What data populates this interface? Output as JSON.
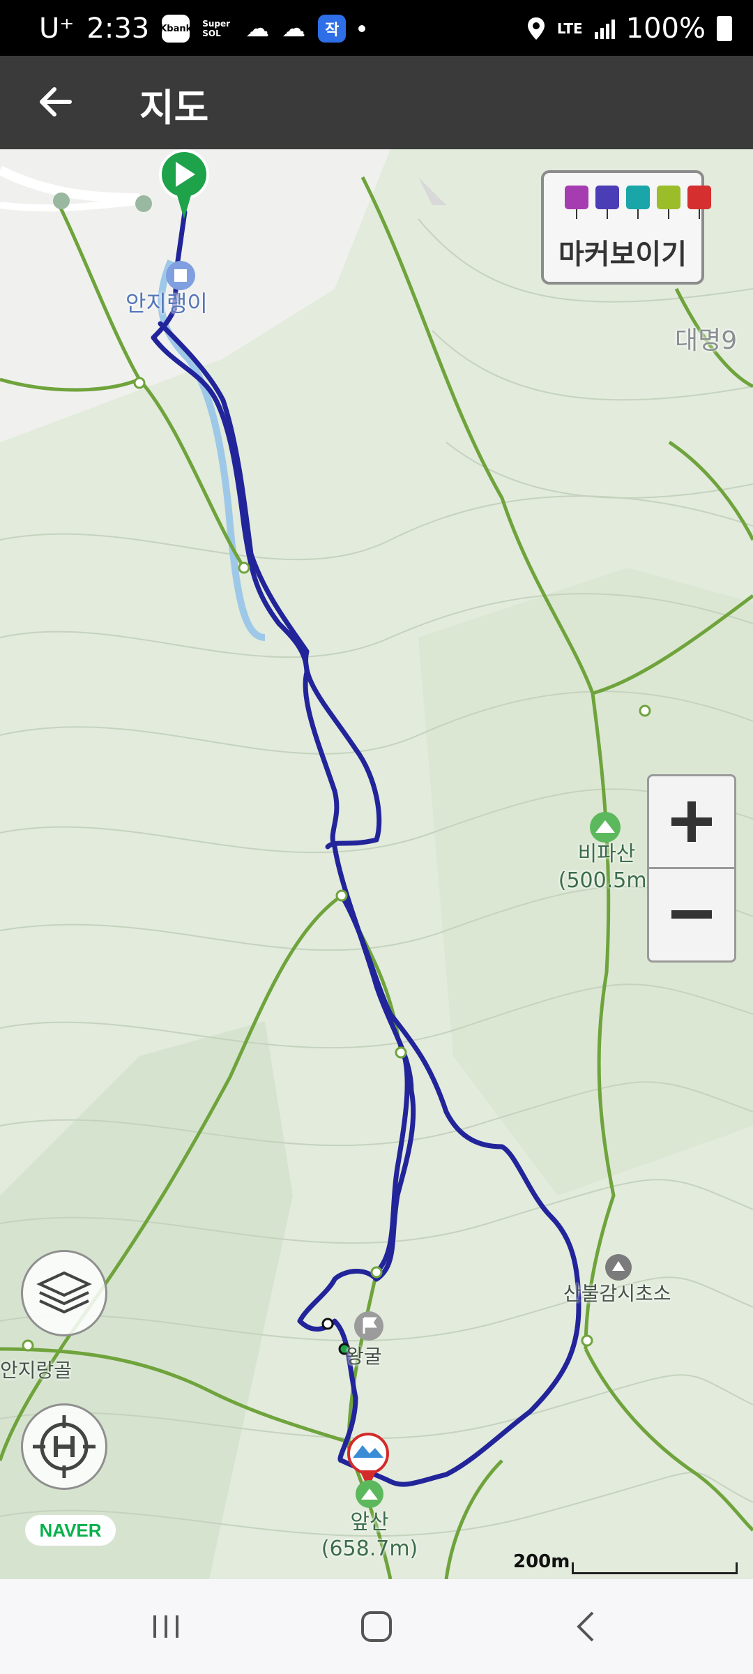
{
  "status_bar": {
    "carrier": "U⁺",
    "time": "2:33",
    "app_icons": [
      "kbank-icon",
      "super-sol-icon",
      "cloud-icon",
      "cloud-icon",
      "jak-icon"
    ],
    "app_icon_texts": [
      "Kbank",
      "Super SOL",
      "작"
    ],
    "network": "LTE",
    "battery": "100%"
  },
  "app_bar": {
    "title": "지도"
  },
  "marker_toggle": {
    "label": "마커보이기",
    "pins": [
      "camera-pin",
      "video-pin",
      "mic-pin",
      "memo-pin",
      "flag-pin"
    ],
    "pin_colors": [
      "#a53db0",
      "#4a3db5",
      "#1aa6a8",
      "#9bbd2a",
      "#d62f2f"
    ]
  },
  "map": {
    "labels": {
      "anjirangi": "안지랭이",
      "daemyeong": "대명9",
      "bipasan": "비파산\n(500.5m)",
      "sanbul": "산불감시초소",
      "wanggul": "왕굴",
      "anjiranggol": "안지랑골",
      "apsan": "앞산\n(658.7m)"
    },
    "track_color": "#22249a",
    "trail_color": "#6fa33c"
  },
  "scale_text": "200m",
  "brand": "NAVER"
}
